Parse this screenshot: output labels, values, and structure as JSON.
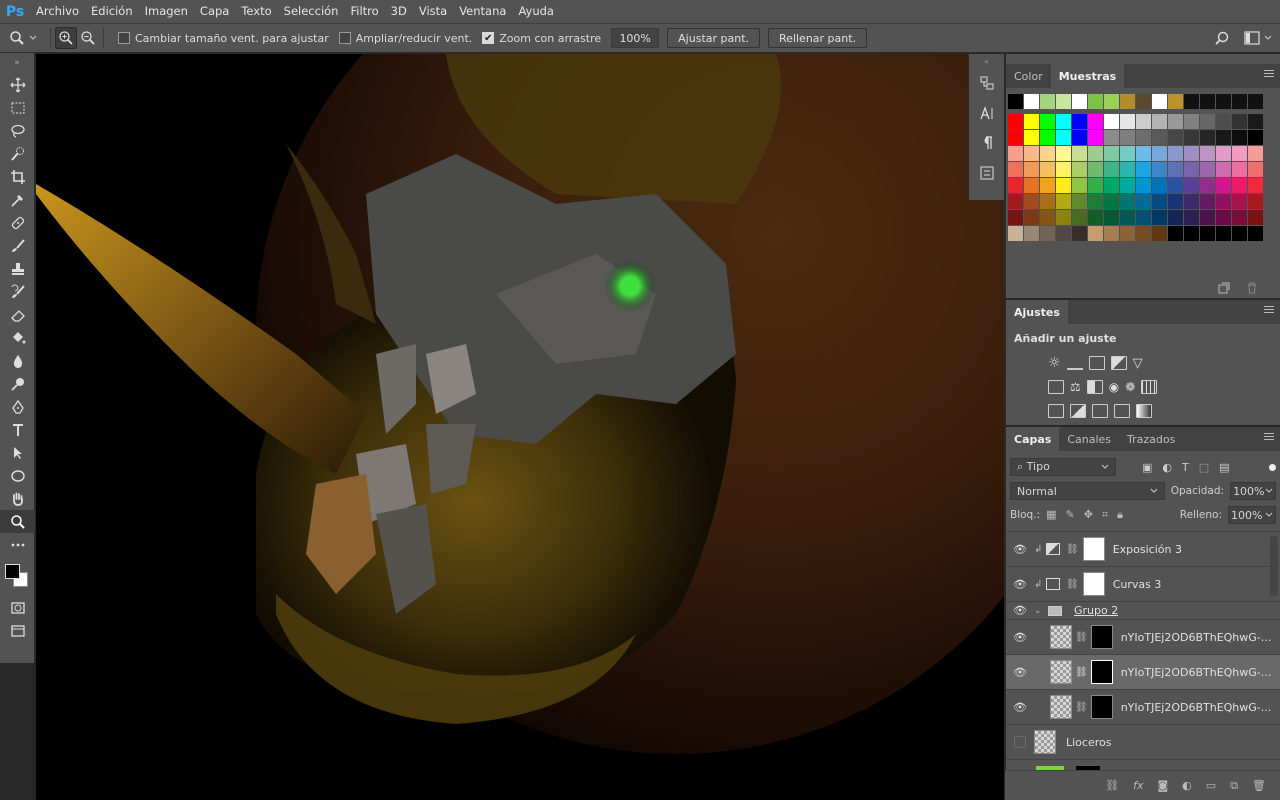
{
  "app": {
    "logo": "Ps"
  },
  "menu": [
    "Archivo",
    "Edición",
    "Imagen",
    "Capa",
    "Texto",
    "Selección",
    "Filtro",
    "3D",
    "Vista",
    "Ventana",
    "Ayuda"
  ],
  "options": {
    "resize_windows": "Cambiar tamaño vent. para ajustar",
    "zoom_all_windows": "Ampliar/reducir vent.",
    "scrubby_zoom": "Zoom con arrastre",
    "zoom_value": "100%",
    "fit_screen": "Ajustar pant.",
    "fill_screen": "Rellenar pant."
  },
  "swatches_panel": {
    "tabs": [
      "Color",
      "Muestras"
    ],
    "active_tab": "Muestras",
    "recent": [
      "#000000",
      "#ffffff",
      "#a3d67a",
      "#c8e6a0",
      "#ffffff",
      "#7cc243",
      "#9ad055",
      "#b38c2d",
      "#5a4a2c",
      "#ffffff",
      "#b8922a",
      "#111111",
      "#111111",
      "#111111",
      "#111111",
      "#111111"
    ],
    "rows": [
      [
        "#ff0000",
        "#ffff00",
        "#00ff00",
        "#00ffff",
        "#0000ff",
        "#ff00ff",
        "#ffffff",
        "#e6e6e6",
        "#cccccc",
        "#b3b3b3",
        "#999999",
        "#808080",
        "#666666",
        "#4d4d4d",
        "#333333",
        "#1a1a1a"
      ],
      [
        "#ff0000",
        "#ffff00",
        "#00ff00",
        "#00ffff",
        "#0000ff",
        "#ff00ff",
        "#8c8c8c",
        "#7f7f7f",
        "#6e6e6e",
        "#5a5a5a",
        "#474747",
        "#383838",
        "#262626",
        "#191919",
        "#0d0d0d",
        "#000000"
      ],
      [
        "#f5a08a",
        "#f8b987",
        "#fbd389",
        "#fff98f",
        "#c6df90",
        "#9ccc90",
        "#7ecaa2",
        "#76cbc7",
        "#6dbbe8",
        "#7aa7d9",
        "#8c97cd",
        "#a18cc4",
        "#be93c4",
        "#e29ac8",
        "#f29ac0",
        "#f49b98"
      ],
      [
        "#f0705a",
        "#f39a59",
        "#f8bd5d",
        "#fff263",
        "#a8d067",
        "#6fbb6e",
        "#3fb58a",
        "#2ab6b1",
        "#1aa6e2",
        "#3e86c7",
        "#5f71b5",
        "#7b62ac",
        "#9c67ad",
        "#d06bb1",
        "#ee6ea0",
        "#f06e6c"
      ],
      [
        "#e5262a",
        "#ea7223",
        "#f4a122",
        "#ffec1d",
        "#8dc63f",
        "#32b149",
        "#00a865",
        "#00a99d",
        "#0096d6",
        "#0072bc",
        "#2e52a3",
        "#5b3f98",
        "#912d8c",
        "#d2168c",
        "#ec1a6b",
        "#ee2b3b"
      ],
      [
        "#9e1b1e",
        "#a24a1a",
        "#aa6f16",
        "#b4a814",
        "#5e8b2c",
        "#1b7e36",
        "#007645",
        "#007670",
        "#006b9a",
        "#004b86",
        "#1b3474",
        "#3c2a6d",
        "#651a63",
        "#930f60",
        "#a5134b",
        "#a5191f"
      ],
      [
        "#7a1314",
        "#7e3912",
        "#845510",
        "#8c830d",
        "#476b20",
        "#115f27",
        "#005934",
        "#005953",
        "#005074",
        "#003866",
        "#132657",
        "#2d1f53",
        "#4c124a",
        "#700848",
        "#7d0c38",
        "#7d1216"
      ],
      [
        "#c7b299",
        "#998675",
        "#736357",
        "#534741",
        "#372f2c",
        "#c69c6d",
        "#a67c52",
        "#8c6239",
        "#754c24",
        "#603913",
        "#000000",
        "#000000",
        "#000000",
        "#000000",
        "#000000",
        "#000000"
      ]
    ]
  },
  "adjustments_panel": {
    "tab": "Ajustes",
    "title": "Añadir un ajuste"
  },
  "layers_panel": {
    "tabs": [
      "Capas",
      "Canales",
      "Trazados"
    ],
    "active_tab": "Capas",
    "filter": "Tipo",
    "blend_mode": "Normal",
    "opacity_label": "Opacidad:",
    "opacity": "100%",
    "lock_label": "Bloq.:",
    "fill_label": "Relleno:",
    "fill": "100%",
    "layers": [
      {
        "name": "Exposición 3",
        "kind": "adjustment",
        "visible": true,
        "selected": false
      },
      {
        "name": "Curvas 3",
        "kind": "adjustment",
        "visible": true,
        "selected": false
      },
      {
        "name": "Grupo 2",
        "kind": "group",
        "visible": true,
        "selected": false
      },
      {
        "name": "nYIoTJEj2OD6BThEQhwG-...",
        "kind": "smart",
        "visible": true,
        "selected": false
      },
      {
        "name": "nYIoTJEj2OD6BThEQhwG-...",
        "kind": "smart",
        "visible": true,
        "selected": true
      },
      {
        "name": "nYIoTJEj2OD6BThEQhwG-...",
        "kind": "smart",
        "visible": true,
        "selected": false
      },
      {
        "name": "Lioceros",
        "kind": "smart",
        "visible": false,
        "selected": false
      }
    ]
  }
}
